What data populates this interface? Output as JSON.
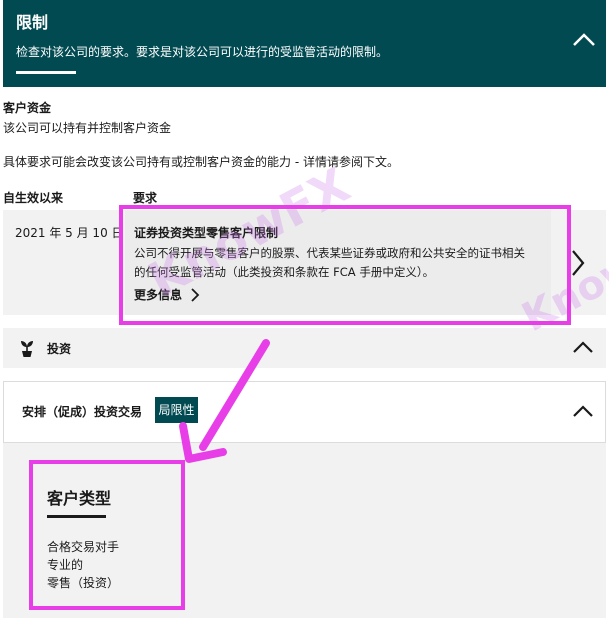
{
  "header": {
    "title": "限制",
    "description": "检查对该公司的要求。要求是对该公司可以进行的受监管活动的限制。"
  },
  "client_money": {
    "heading": "客户资金",
    "text": "该公司可以持有并控制客户资金",
    "note": "具体要求可能会改变该公司持有或控制客户资金的能力 - 详情请参阅下文。"
  },
  "table": {
    "col_effective": "自生效以来",
    "col_requirement": "要求",
    "row": {
      "date": "2021 年 5 月 10 日",
      "title": "证券投资类型零售客户限制",
      "line1": "公司不得开展与零售客户的股票、代表某些证券或政府和公共安全的证书相关",
      "line2": "的任何受监管活动（此类投资和条款在 FCA 手册中定义）。",
      "more": "更多信息"
    }
  },
  "investment": {
    "label": "投资"
  },
  "arrangement": {
    "label": "安排（促成）投资交易",
    "badge": "局限性"
  },
  "client_type": {
    "title": "客户类型",
    "items": [
      "合格交易对手",
      "专业的",
      "零售（投资）"
    ]
  },
  "watermark": {
    "text": "KnowFX"
  },
  "colors": {
    "primary": "#024a51",
    "annotation": "#e83ee8",
    "watermark": "#cc78eb"
  },
  "icons": {
    "collapse": "chevron-up-icon",
    "expand": "chevron-right-icon",
    "investment": "plant-icon"
  }
}
